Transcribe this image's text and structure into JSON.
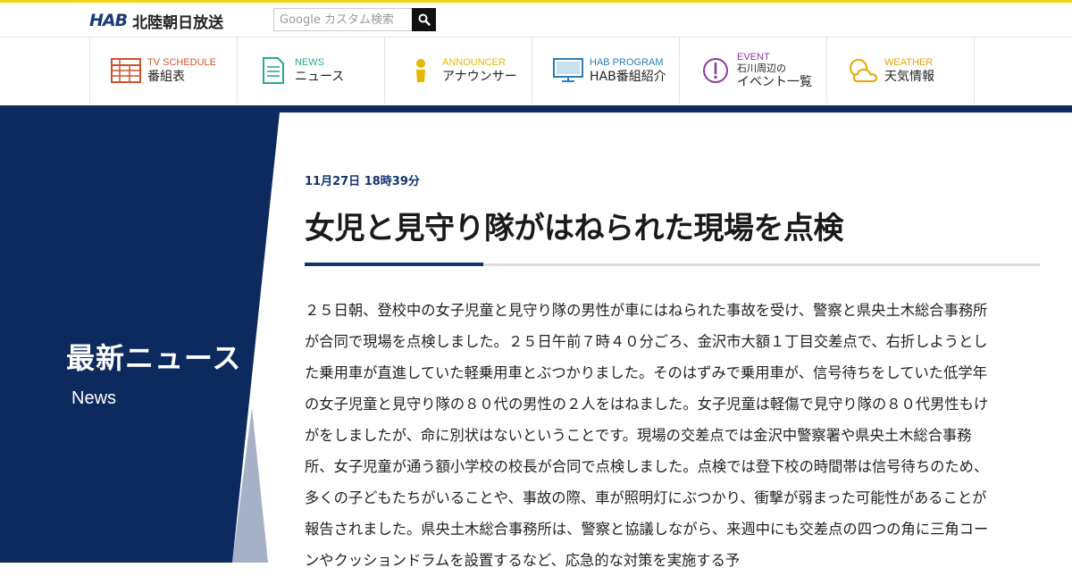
{
  "header": {
    "logo_mark": "HAB",
    "logo_name": "北陸朝日放送",
    "search": {
      "placeholder": "Google カスタム検索"
    }
  },
  "nav": {
    "items": [
      {
        "en": "TV SCHEDULE",
        "ja": "番組表",
        "icon": "tv-schedule-icon",
        "color": "#d0522b"
      },
      {
        "en": "NEWS",
        "ja": "ニュース",
        "icon": "news-icon",
        "color": "#2ca890"
      },
      {
        "en": "ANNOUNCER",
        "ja": "アナウンサー",
        "icon": "announcer-icon",
        "color": "#e6b800"
      },
      {
        "en": "HAB PROGRAM",
        "ja": "HAB番組紹介",
        "icon": "monitor-icon",
        "color": "#2a7fb5"
      },
      {
        "en": "EVENT",
        "ja_small": "石川周辺の",
        "ja": "イベント一覧",
        "icon": "event-icon",
        "color": "#8a3aa0"
      },
      {
        "en": "WEATHER",
        "ja": "天気情報",
        "icon": "weather-icon",
        "color": "#e6a700"
      }
    ]
  },
  "sidebar": {
    "title": "最新ニュース",
    "subtitle": "News"
  },
  "article": {
    "date": "11月27日 18時39分",
    "title": "女児と見守り隊がはねられた現場を点検",
    "body": "２５日朝、登校中の女子児童と見守り隊の男性が車にはねられた事故を受け、警察と県央土木総合事務所が合同で現場を点検しました。２５日午前７時４０分ごろ、金沢市大額１丁目交差点で、右折しようとした乗用車が直進していた軽乗用車とぶつかりました。そのはずみで乗用車が、信号待ちをしていた低学年の女子児童と見守り隊の８０代の男性の２人をはねました。女子児童は軽傷で見守り隊の８０代男性もけがをしましたが、命に別状はないということです。現場の交差点では金沢中警察署や県央土木総合事務所、女子児童が通う額小学校の校長が合同で点検しました。点検では登下校の時間帯は信号待ちのため、多くの子どもたちがいることや、事故の際、車が照明灯にぶつかり、衝撃が弱まった可能性があることが報告されました。県央土木総合事務所は、警察と協議しながら、来週中にも交差点の四つの角に三角コーンやクッションドラムを設置するなど、応急的な対策を実施する予"
  },
  "colors": {
    "accent_yellow": "#f2d516",
    "navy": "#0d2a5e",
    "date_blue": "#14346e"
  }
}
